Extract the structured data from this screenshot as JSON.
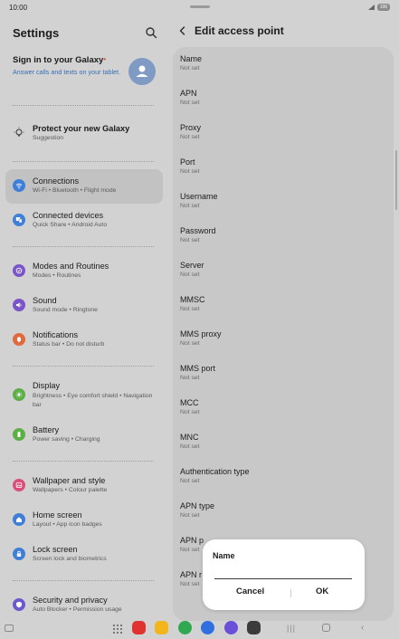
{
  "status": {
    "time": "10:00",
    "battery": "100"
  },
  "settings": {
    "title": "Settings",
    "account": {
      "title": "Sign in to your Galaxy",
      "subtitle": "Answer calls and texts on your tablet."
    },
    "items": [
      {
        "label": "Protect your new Galaxy",
        "sub": "Suggestion",
        "icon": "lightbulb-icon",
        "color": "#d2d2d2"
      },
      {
        "label": "Connections",
        "sub": "Wi-Fi  •  Bluetooth  •  Flight mode",
        "icon": "wifi-icon",
        "color": "#3f7fd8"
      },
      {
        "label": "Connected devices",
        "sub": "Quick Share  •  Android Auto",
        "icon": "devices-icon",
        "color": "#3f7fd8"
      },
      {
        "label": "Modes and Routines",
        "sub": "Modes  •  Routines",
        "icon": "routines-icon",
        "color": "#7a55c9"
      },
      {
        "label": "Sound",
        "sub": "Sound mode  •  Ringtone",
        "icon": "volume-icon",
        "color": "#7a55c9"
      },
      {
        "label": "Notifications",
        "sub": "Status bar  •  Do not disturb",
        "icon": "bell-icon",
        "color": "#e06a3b"
      },
      {
        "label": "Display",
        "sub": "Brightness  •  Eye comfort shield  •  Navigation bar",
        "icon": "sun-icon",
        "color": "#5caf45"
      },
      {
        "label": "Battery",
        "sub": "Power saving  •  Charging",
        "icon": "battery-icon",
        "color": "#5caf45"
      },
      {
        "label": "Wallpaper and style",
        "sub": "Wallpapers  •  Colour palette",
        "icon": "palette-icon",
        "color": "#d94f7a"
      },
      {
        "label": "Home screen",
        "sub": "Layout  •  App icon badges",
        "icon": "home-icon",
        "color": "#3f7fd8"
      },
      {
        "label": "Lock screen",
        "sub": "Screen lock and biometrics",
        "icon": "lock-icon",
        "color": "#3f7fd8"
      },
      {
        "label": "Security and privacy",
        "sub": "Auto Blocker  •  Permission usage",
        "icon": "shield-icon",
        "color": "#6a5acd"
      }
    ]
  },
  "apn": {
    "title": "Edit access point",
    "fields": [
      {
        "label": "Name",
        "value": "Not set"
      },
      {
        "label": "APN",
        "value": "Not set"
      },
      {
        "label": "Proxy",
        "value": "Not set"
      },
      {
        "label": "Port",
        "value": "Not set"
      },
      {
        "label": "Username",
        "value": "Not set"
      },
      {
        "label": "Password",
        "value": "Not set"
      },
      {
        "label": "Server",
        "value": "Not set"
      },
      {
        "label": "MMSC",
        "value": "Not set"
      },
      {
        "label": "MMS proxy",
        "value": "Not set"
      },
      {
        "label": "MMS port",
        "value": "Not set"
      },
      {
        "label": "MCC",
        "value": "Not set"
      },
      {
        "label": "MNC",
        "value": "Not set"
      },
      {
        "label": "Authentication type",
        "value": "Not set"
      },
      {
        "label": "APN type",
        "value": "Not set"
      },
      {
        "label": "APN p",
        "value": "Not set"
      },
      {
        "label": "APN r",
        "value": "Not set"
      }
    ]
  },
  "dialog": {
    "title": "Name",
    "value": "",
    "cancel": "Cancel",
    "ok": "OK"
  },
  "dock": [
    {
      "icon": "office-app-icon",
      "color": "#e0322e"
    },
    {
      "icon": "files-app-icon",
      "color": "#f2b51c"
    },
    {
      "icon": "phone-app-icon",
      "color": "#2fa84f"
    },
    {
      "icon": "messages-app-icon",
      "color": "#2f6fe0"
    },
    {
      "icon": "internet-app-icon",
      "color": "#6a4fd8"
    },
    {
      "icon": "camera-app-icon",
      "color": "#3b3b3b"
    }
  ]
}
